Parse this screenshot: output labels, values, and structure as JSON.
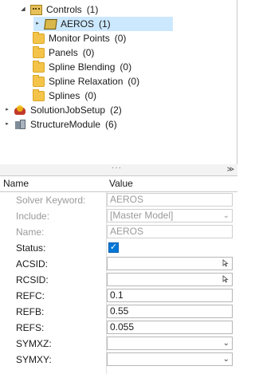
{
  "tree": {
    "items": [
      {
        "label": "Controls",
        "count": "(1)"
      },
      {
        "label": "AEROS",
        "count": "(1)"
      },
      {
        "label": "Monitor Points",
        "count": "(0)"
      },
      {
        "label": "Panels",
        "count": "(0)"
      },
      {
        "label": "Spline Blending",
        "count": "(0)"
      },
      {
        "label": "Spline Relaxation",
        "count": "(0)"
      },
      {
        "label": "Splines",
        "count": "(0)"
      },
      {
        "label": "SolutionJobSetup",
        "count": "(2)"
      },
      {
        "label": "StructureModule",
        "count": "(6)"
      }
    ]
  },
  "grid": {
    "header": {
      "name": "Name",
      "value": "Value"
    },
    "rows": [
      {
        "label": "Solver Keyword:",
        "value": "AEROS"
      },
      {
        "label": "Include:",
        "value": "[Master Model]"
      },
      {
        "label": "Name:",
        "value": "AEROS"
      },
      {
        "label": "Status:",
        "value": "checked"
      },
      {
        "label": "ACSID:",
        "value": ""
      },
      {
        "label": "RCSID:",
        "value": ""
      },
      {
        "label": "REFC:",
        "value": "0.1"
      },
      {
        "label": "REFB:",
        "value": "0.55"
      },
      {
        "label": "REFS:",
        "value": "0.055"
      },
      {
        "label": "SYMXZ:",
        "value": ""
      },
      {
        "label": "SYMXY:",
        "value": ""
      }
    ]
  },
  "colors": {
    "selection": "#cce8ff",
    "checkbox": "#0078d7",
    "folder": "#f4c44a"
  }
}
